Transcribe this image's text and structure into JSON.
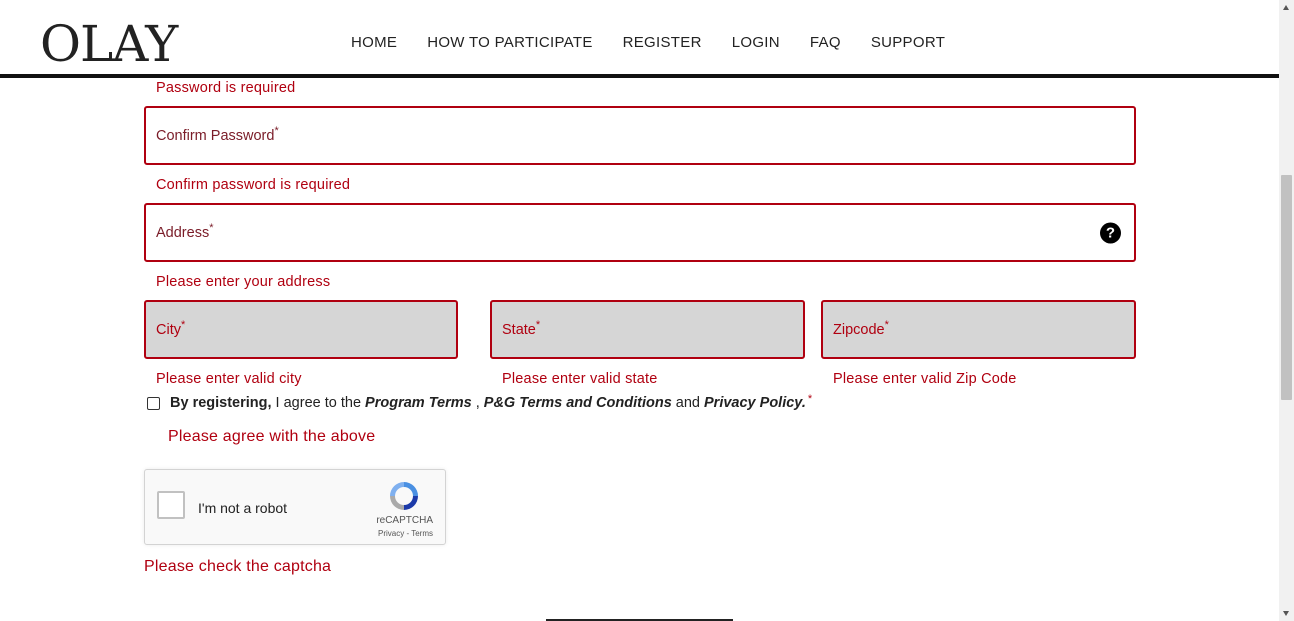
{
  "brand": {
    "logo": "OLAY"
  },
  "nav": [
    "HOME",
    "HOW TO PARTICIPATE",
    "REGISTER",
    "LOGIN",
    "FAQ",
    "SUPPORT"
  ],
  "errors": {
    "password": "Password is required",
    "confirm": "Confirm password is required",
    "address": "Please enter your address",
    "city": "Please enter valid city",
    "state": "Please enter valid state",
    "zip": "Please enter valid Zip Code",
    "agree": "Please agree with the above",
    "captcha": "Please check the captcha"
  },
  "fields": {
    "confirm": "Confirm Password",
    "address": "Address",
    "city": "City",
    "state": "State",
    "zip": "Zipcode",
    "required_mark": "*",
    "help_glyph": "?"
  },
  "agree": {
    "bold": "By registering,",
    "text1": " I agree to the ",
    "program_terms": "Program Terms",
    "sep": " , ",
    "pg_terms": "P&G Terms and Conditions",
    "and": " and ",
    "privacy": "Privacy Policy.",
    "required_mark": "*"
  },
  "captcha": {
    "label": "I'm not a robot",
    "brand": "reCAPTCHA",
    "links": "Privacy - Terms"
  },
  "colors": {
    "error": "#b00010",
    "field_disabled": "#d6d6d6",
    "header_border": "#111111"
  }
}
